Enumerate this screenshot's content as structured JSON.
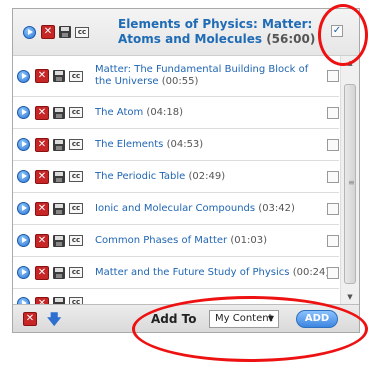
{
  "header": {
    "title": "Elements of Physics: Matter: Atoms and Molecules",
    "duration": "(56:00)",
    "checked": true
  },
  "items": [
    {
      "title": "Matter: The Fundamental Building Block of the Universe",
      "duration": "(00:55)"
    },
    {
      "title": "The Atom",
      "duration": "(04:18)"
    },
    {
      "title": "The Elements",
      "duration": "(04:53)"
    },
    {
      "title": "The Periodic Table",
      "duration": "(02:49)"
    },
    {
      "title": "Ionic and Molecular Compounds",
      "duration": "(03:42)"
    },
    {
      "title": "Common Phases of Matter",
      "duration": "(01:03)"
    },
    {
      "title": "Matter and the Future Study of Physics",
      "duration": "(00:24)"
    }
  ],
  "footer": {
    "add_to_label": "Add To",
    "selected_option": "My Content",
    "add_button_label": "ADD"
  },
  "icons": {
    "play": "play-icon",
    "remove": "remove-icon",
    "save": "save-icon",
    "captions": "cc-icon",
    "checkbox": "checkbox",
    "move_down": "arrow-down-icon"
  },
  "colors": {
    "link": "#1f6bb5",
    "remove": "#c62626",
    "add_button": "#3d86e0",
    "annotation": "#e11111"
  }
}
